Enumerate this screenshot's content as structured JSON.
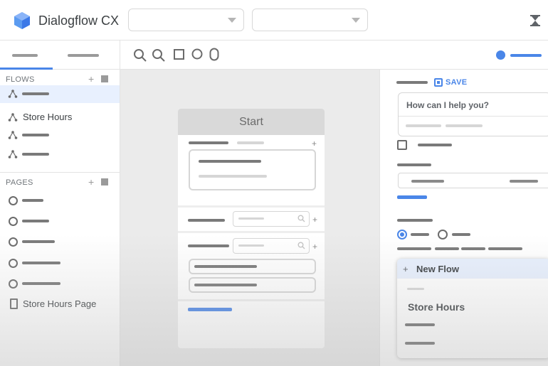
{
  "header": {
    "app_title": "Dialogflow CX",
    "agent_select": "",
    "environment_select": "",
    "icons": {
      "logo": "dialogflow-cube-logo",
      "status": "hourglass-icon"
    }
  },
  "toolbar": {
    "tools": [
      "zoom-out-icon",
      "zoom-in-icon",
      "square-icon",
      "circle-icon",
      "stadium-icon"
    ],
    "toggle_icon": "toggle-switch-icon"
  },
  "left_panel": {
    "flows": {
      "label": "FLOWS",
      "add_icon": "plus-icon",
      "items": [
        {
          "label": "",
          "selected": true
        },
        {
          "label": "Store Hours",
          "selected": false
        },
        {
          "label": "",
          "selected": false
        },
        {
          "label": "",
          "selected": false
        }
      ]
    },
    "pages": {
      "label": "PAGES",
      "add_icon": "plus-icon",
      "items": [
        {
          "label": ""
        },
        {
          "label": ""
        },
        {
          "label": ""
        },
        {
          "label": ""
        },
        {
          "label": ""
        },
        {
          "label": "Store Hours Page"
        }
      ]
    }
  },
  "canvas": {
    "start_node": {
      "title": "Start"
    }
  },
  "right_panel": {
    "save_label": "SAVE",
    "prompt_text": "How can I help you?",
    "flow_menu": {
      "new_flow_label": "New Flow",
      "items": [
        "Store Hours"
      ]
    }
  },
  "colors": {
    "accent": "#4a86e8",
    "selected_bg": "#e8f0fe",
    "canvas_bg": "#ebebeb"
  }
}
